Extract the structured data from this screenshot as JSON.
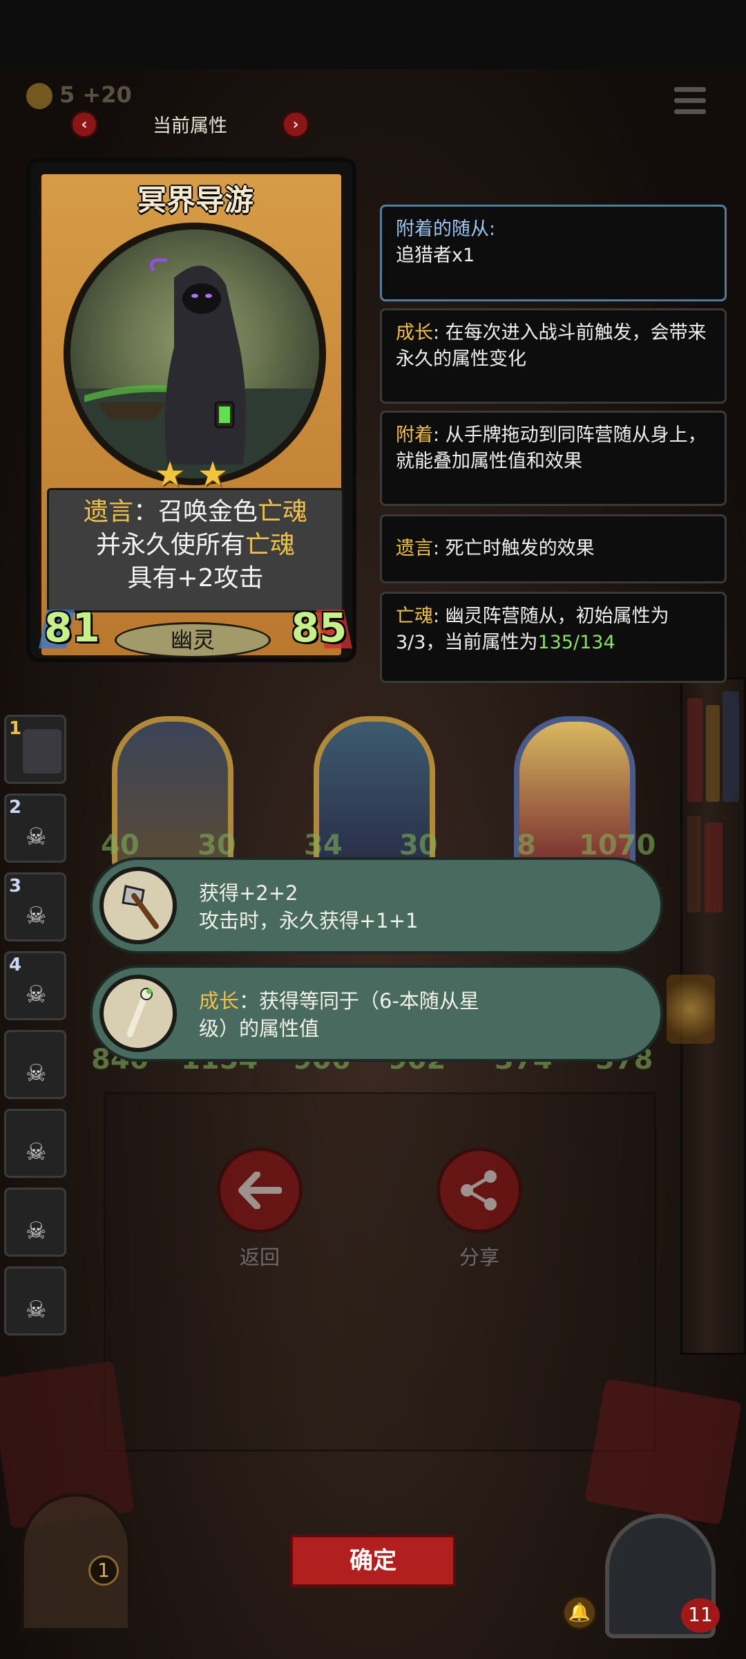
{
  "header": {
    "coin_text": "5 +20",
    "title": "当前属性",
    "prev_icon": "chevron-left-icon",
    "next_icon": "chevron-right-icon",
    "menu_icon": "hamburger-menu-icon"
  },
  "card": {
    "name": "冥界导游",
    "stars": 2,
    "desc_line1_a": "遗言",
    "desc_line1_b": "：召唤金色",
    "desc_line1_c": "亡魂",
    "desc_line2_a": "并永久使所有",
    "desc_line2_b": "亡魂",
    "desc_line3": "具有+2攻击",
    "attack": "81",
    "health": "85",
    "tribe": "幽灵"
  },
  "info": [
    {
      "key": "附着的随从:",
      "text": "追猎者x1"
    },
    {
      "key": "成长",
      "text": ": 在每次进入战斗前触发，会带来永久的属性变化"
    },
    {
      "key": "附着",
      "text": ": 从手牌拖动到同阵营随从身上，就能叠加属性值和效果"
    },
    {
      "key": "遗言",
      "text": ": 死亡时触发的效果"
    },
    {
      "key": "亡魂",
      "text_a": ": 幽灵阵营随从，初始属性为3/3，当前属性为",
      "text_b": "135/134"
    }
  ],
  "slots": [
    "1",
    "2",
    "3",
    "4",
    "",
    "",
    "",
    ""
  ],
  "minions": [
    {
      "atk": "40",
      "hp": "30",
      "atk2": "840",
      "hp2": "1154"
    },
    {
      "atk": "34",
      "hp": "30",
      "atk2": "906",
      "hp2": "902"
    },
    {
      "atk": "8",
      "hp": "1070",
      "atk2": "374",
      "hp2": "378"
    }
  ],
  "tooltips": [
    {
      "line1": "获得+2+2",
      "line2": "攻击时，永久获得+1+1",
      "icon": "axe-icon"
    },
    {
      "key": "成长",
      "line1": "：获得等同于（6-本随从星",
      "line2": "级）的属性值",
      "icon": "bone-staff-icon"
    }
  ],
  "buttons": {
    "back_label": "返回",
    "share_label": "分享",
    "confirm_label": "确定"
  },
  "footer": {
    "left_count": "1",
    "right_count": "11"
  },
  "colors": {
    "accent_red": "#b21f1f",
    "keyword_gold": "#f0c14a",
    "stat_green": "#8fe06a",
    "tooltip_teal": "#496a5f"
  }
}
